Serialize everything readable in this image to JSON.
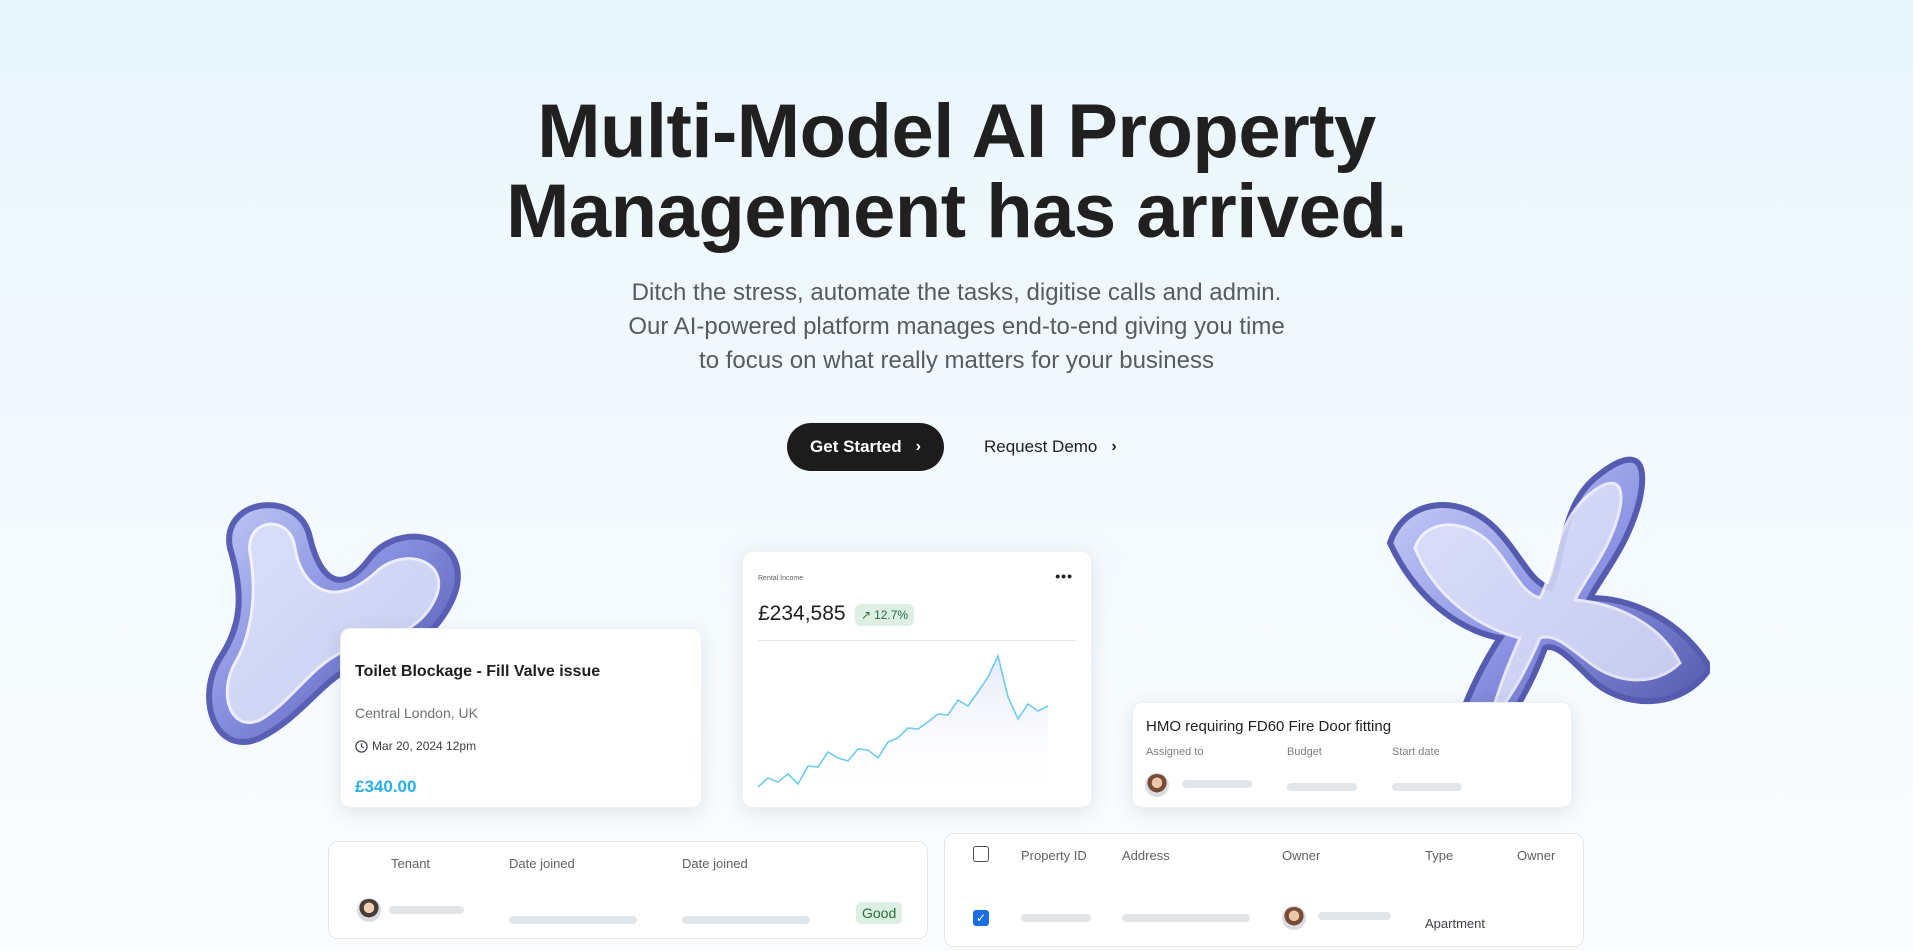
{
  "hero": {
    "title_line1": "Multi-Model AI Property",
    "title_line2": "Management has arrived.",
    "subtitle_line1": "Ditch the stress, automate the tasks, digitise calls and admin.",
    "subtitle_line2": "Our AI-powered platform manages end-to-end giving you time",
    "subtitle_line3": "to focus on what really matters for your business",
    "primary_cta": "Get Started",
    "secondary_cta": "Request Demo"
  },
  "ticket_card": {
    "title": "Toilet Blockage - Fill Valve issue",
    "location": "Central London, UK",
    "date": "Mar 20, 2024 12pm",
    "price": "£340.00"
  },
  "income_card": {
    "label": "Rental Income",
    "menu": "•••",
    "value": "£234,585",
    "change": "12.7%",
    "change_icon": "arrow-up-right-icon",
    "line_color": "#6fcbf0"
  },
  "hmo_card": {
    "title": "HMO requiring FD60 Fire Door fitting",
    "assigned_label": "Assigned to",
    "budget_label": "Budget",
    "start_label": "Start date"
  },
  "tenant_table": {
    "col_tenant": "Tenant",
    "col_date1": "Date joined",
    "col_date2": "Date joined",
    "status": "Good"
  },
  "property_table": {
    "col_id": "Property ID",
    "col_address": "Address",
    "col_owner": "Owner",
    "col_type": "Type",
    "col_owner2": "Owner",
    "row_type": "Apartment",
    "row_checked": "✓"
  },
  "colors": {
    "accent_blue": "#2aaee8",
    "dark_button": "#1c1c1c",
    "badge_green_bg": "#dcefe2",
    "badge_green_text": "#266c3e"
  }
}
